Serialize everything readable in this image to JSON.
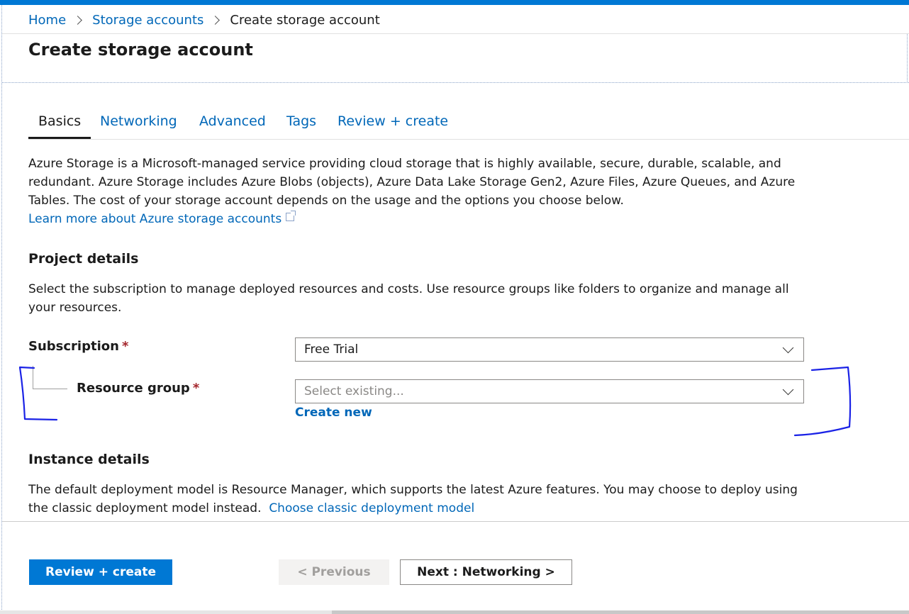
{
  "breadcrumb": {
    "home": "Home",
    "storage_accounts": "Storage accounts",
    "current": "Create storage account"
  },
  "page_title": "Create storage account",
  "tabs": [
    {
      "label": "Basics",
      "active": true
    },
    {
      "label": "Networking",
      "active": false
    },
    {
      "label": "Advanced",
      "active": false
    },
    {
      "label": "Tags",
      "active": false
    },
    {
      "label": "Review + create",
      "active": false
    }
  ],
  "intro": {
    "text": "Azure Storage is a Microsoft-managed service providing cloud storage that is highly available, secure, durable, scalable, and redundant. Azure Storage includes Azure Blobs (objects), Azure Data Lake Storage Gen2, Azure Files, Azure Queues, and Azure Tables. The cost of your storage account depends on the usage and the options you choose below.",
    "learn_more": "Learn more about Azure storage accounts"
  },
  "project_details": {
    "title": "Project details",
    "description": "Select the subscription to manage deployed resources and costs. Use resource groups like folders to organize and manage all your resources.",
    "subscription_label": "Subscription",
    "subscription_value": "Free Trial",
    "resource_group_label": "Resource group",
    "resource_group_placeholder": "Select existing...",
    "create_new": "Create new",
    "required_marker": "*"
  },
  "instance_details": {
    "title": "Instance details",
    "description": "The default deployment model is Resource Manager, which supports the latest Azure features. You may choose to deploy using the classic deployment model instead.",
    "classic_link": "Choose classic deployment model"
  },
  "footer": {
    "review_create": "Review + create",
    "previous": "< Previous",
    "next": "Next : Networking >"
  },
  "colors": {
    "accent": "#0078d4",
    "link": "#0067b8",
    "required": "#a4262c",
    "annotation_ink": "#1a22e6"
  },
  "icons": [
    "chevron-right-icon",
    "external-link-icon",
    "chevron-down-icon"
  ]
}
